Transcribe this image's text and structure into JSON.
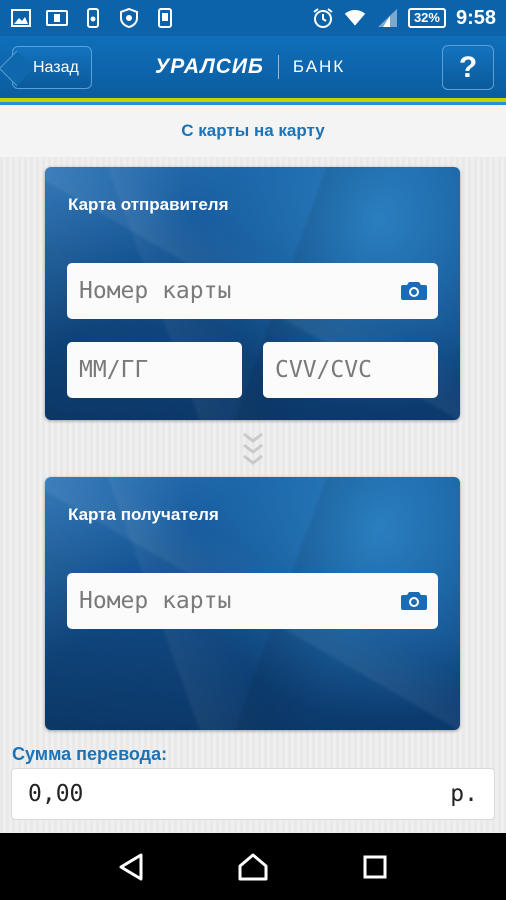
{
  "status_bar": {
    "battery": "32%",
    "time": "9:58"
  },
  "header": {
    "back_label": "Назад",
    "logo_main": "УРАЛСИБ",
    "logo_sub": "БАНК",
    "help_label": "?"
  },
  "page": {
    "title": "С карты на карту"
  },
  "sender_card": {
    "title": "Карта отправителя",
    "number_placeholder": "Номер карты",
    "expiry_placeholder": "ММ/ГГ",
    "cvv_placeholder": "CVV/CVC"
  },
  "recipient_card": {
    "title": "Карта получателя",
    "number_placeholder": "Номер карты"
  },
  "amount": {
    "label": "Сумма перевода:",
    "value": "0,00",
    "currency": "р."
  },
  "colors": {
    "brand_blue": "#0d63a9",
    "accent_yellow": "#c8d400",
    "title_blue": "#1b73b8"
  }
}
